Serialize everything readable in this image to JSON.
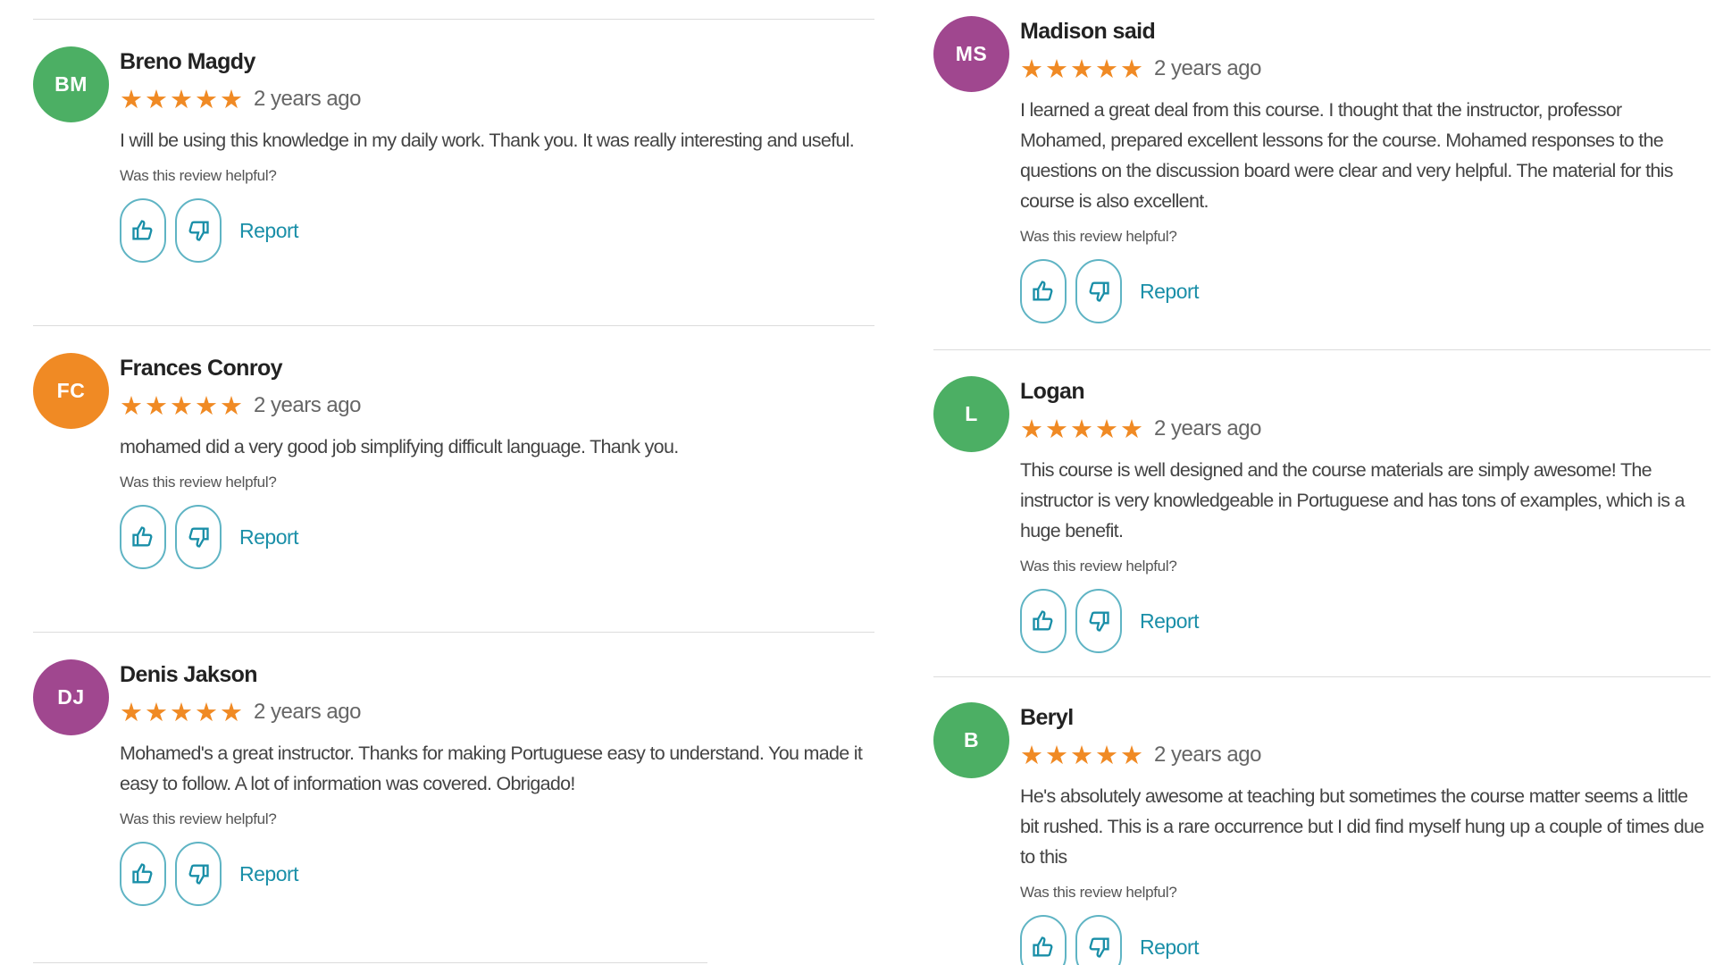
{
  "helpful_prompt": "Was this review helpful?",
  "report_label": "Report",
  "star_glyph": "★",
  "colors": {
    "star": "#f08a24",
    "link": "#1a8fa8",
    "vote_border": "#5fb4c4",
    "green_avatar": "#4caf64",
    "orange_avatar": "#f08a24",
    "purple_avatar": "#a0478f"
  },
  "reviews_left": [
    {
      "initials": "BM",
      "name": "Breno Magdy",
      "rating": 5,
      "age": "2 years ago",
      "text": "I will be using this knowledge in my daily work. Thank you. It was really interesting and useful."
    },
    {
      "initials": "FC",
      "name": "Frances Conroy",
      "rating": 5,
      "age": "2 years ago",
      "text": "mohamed did a very good job simplifying difficult language. Thank you."
    },
    {
      "initials": "DJ",
      "name": "Denis Jakson",
      "rating": 5,
      "age": "2 years ago",
      "text": "Mohamed's a great instructor. Thanks for making Portuguese easy to understand. You made it easy to follow. A lot of information was covered. Obrigado!"
    }
  ],
  "reviews_right": [
    {
      "initials": "MS",
      "name": "Madison said",
      "rating": 5,
      "age": "2 years ago",
      "text": "I learned a great deal from this course. I thought that the instructor, professor Mohamed, prepared excellent lessons for the course. Mohamed responses to the questions on the discussion board were clear and very helpful. The material for this course is also excellent."
    },
    {
      "initials": "L",
      "name": "Logan",
      "rating": 5,
      "age": "2 years ago",
      "text": "This course is well designed and the course materials are simply awesome! The instructor is very knowledgeable in Portuguese and has tons of examples, which is a huge benefit."
    },
    {
      "initials": "B",
      "name": "Beryl",
      "rating": 5,
      "age": "2 years ago",
      "text": "He's absolutely awesome at teaching but sometimes the course matter seems a little bit rushed. This is a rare occurrence but I did find myself hung up a couple of times due to this"
    }
  ]
}
